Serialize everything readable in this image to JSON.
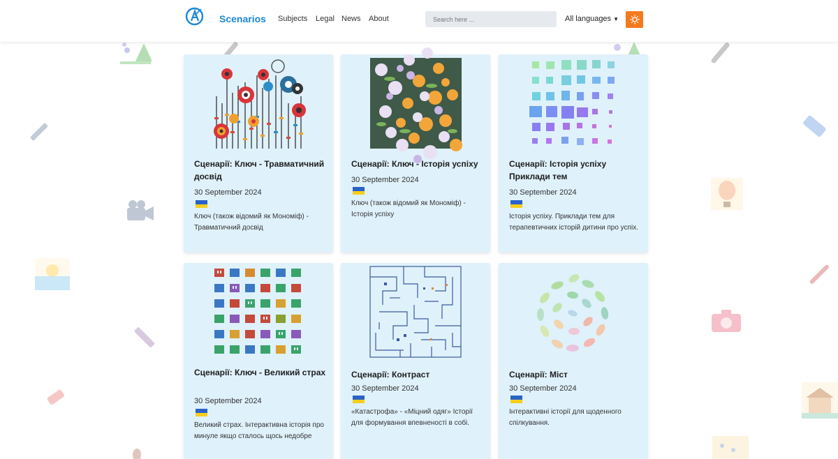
{
  "nav": {
    "brand": "Scenarios",
    "links": [
      "Subjects",
      "Legal",
      "News",
      "About"
    ],
    "search_placeholder": "Search here ...",
    "language": "All languages"
  },
  "cards": [
    {
      "title": "Сценарії: Ключ - Травматичний досвід",
      "date": "30 September 2024",
      "description": "Ключ (також відомий як Мономіф) - Травматичний досвід"
    },
    {
      "title": "Сценарії: Ключ - Історія успіху",
      "date": "30 September 2024",
      "description": "Ключ (також відомий як Мономіф) - Історія успіху"
    },
    {
      "title": "Сценарії: Історія успіху Приклади тем",
      "date": "30 September 2024",
      "description": "Історія успіху. Приклади тем для терапевтичних історій дитини про успіх."
    },
    {
      "title": "Сценарії: Ключ - Великий страх",
      "date": "30 September 2024",
      "description": "Великий страх. Інтерактивна історія про минуле якщо сталось щось недобре"
    },
    {
      "title": "Сценарії: Контраст",
      "date": "30 September 2024",
      "description": "«Катастрофа» - «Міцний одяг» Історії для формування впевненості в собі."
    },
    {
      "title": "Сценарії: Міст",
      "date": "30 September 2024",
      "description": "Інтерактивні історії для щоденного спілкування."
    }
  ],
  "colors": {
    "brand": "#1e88d6",
    "card_bg": "#dff1fb",
    "theme_button": "#f47a1f",
    "flag_blue": "#2a62c8",
    "flag_yellow": "#f7cf1b"
  }
}
